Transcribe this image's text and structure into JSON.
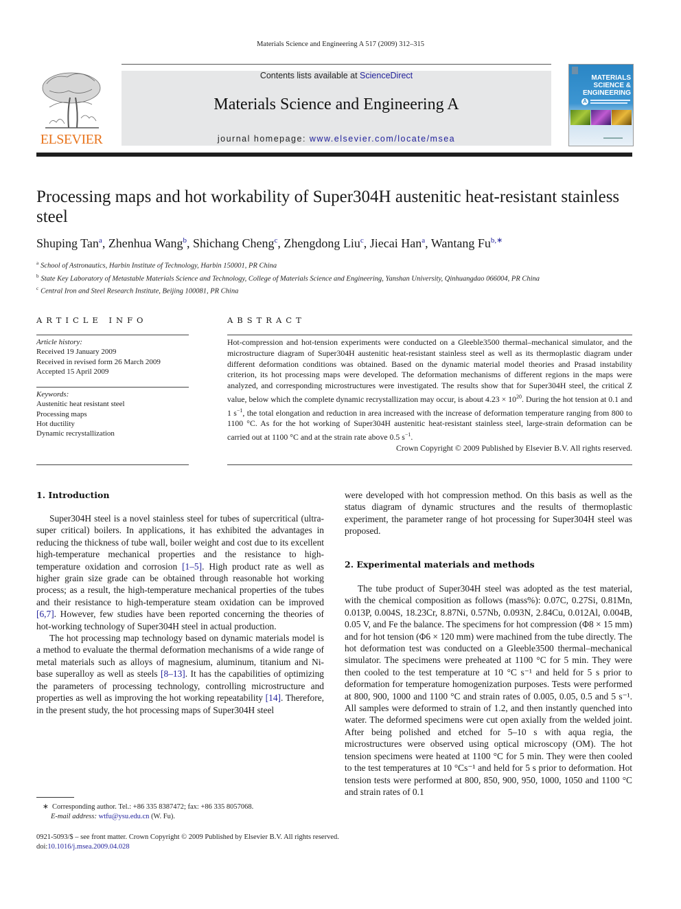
{
  "running_head": "Materials Science and Engineering A 517 (2009) 312–315",
  "header": {
    "publisher_logo_word": "ELSEVIER",
    "contents_prefix": "Contents lists available at ",
    "contents_link": "ScienceDirect",
    "journal_title": "Materials Science and Engineering A",
    "homepage_prefix": "journal homepage: ",
    "homepage_link": "www.elsevier.com/locate/msea",
    "cover": {
      "line1": "MATERIALS",
      "line2": "SCIENCE &",
      "line3": "ENGINEERING",
      "badge": "A"
    },
    "colors": {
      "elsevier_orange": "#e8741c",
      "link_blue": "#1f1f9a",
      "banner_gray": "#e6e7e8"
    }
  },
  "article": {
    "title": "Processing maps and hot workability of Super304H austenitic heat-resistant stainless steel",
    "authors": [
      {
        "name": "Shuping Tan",
        "sup": "a"
      },
      {
        "name": "Zhenhua Wang",
        "sup": "b"
      },
      {
        "name": "Shichang Cheng",
        "sup": "c"
      },
      {
        "name": "Zhengdong Liu",
        "sup": "c"
      },
      {
        "name": "Jiecai Han",
        "sup": "a"
      },
      {
        "name": "Wantang Fu",
        "sup": "b,∗"
      }
    ],
    "affiliations": [
      {
        "key": "a",
        "text": "School of Astronautics, Harbin Institute of Technology, Harbin 150001, PR China"
      },
      {
        "key": "b",
        "text": "State Key Laboratory of Metastable Materials Science and Technology, College of Materials Science and Engineering, Yanshan University, Qinhuangdao 066004, PR China"
      },
      {
        "key": "c",
        "text": "Central Iron and Steel Research Institute, Beijing 100081, PR China"
      }
    ]
  },
  "article_info": {
    "heading": "ARTICLE INFO",
    "history_label": "Article history:",
    "history": [
      "Received 19 January 2009",
      "Received in revised form 26 March 2009",
      "Accepted 15 April 2009"
    ],
    "keywords_label": "Keywords:",
    "keywords": [
      "Austenitic heat resistant steel",
      "Processing maps",
      "Hot ductility",
      "Dynamic recrystallization"
    ]
  },
  "abstract": {
    "heading": "ABSTRACT",
    "p1": "Hot-compression and hot-tension experiments were conducted on a Gleeble3500 thermal–mechanical simulator, and the microstructure diagram of Super304H austenitic heat-resistant stainless steel as well as its thermoplastic diagram under different deformation conditions was obtained. Based on the dynamic material model theories and Prasad instability criterion, its hot processing maps were developed. The deformation mechanisms of different regions in the maps were analyzed, and corresponding microstructures were investigated. The results show that for Super304H steel, the critical Z value, below which the complete dynamic recrystallization may occur, is about 4.23 × 10",
    "p1_exp": "20",
    "p2": ". During the hot tension at 0.1 and 1 s",
    "p2_exp": "−1",
    "p3": ", the total elongation and reduction in area increased with the increase of deformation temperature ranging from 800 to 1100 °C. As for the hot working of Super304H austenitic heat-resistant stainless steel, large-strain deformation can be carried out at 1100 °C and at the strain rate above 0.5 s",
    "p3_exp": "−1",
    "p4": ".",
    "copyright": "Crown Copyright © 2009 Published by Elsevier B.V. All rights reserved."
  },
  "section1": {
    "heading": "1.  Introduction",
    "para1_a": "Super304H steel is a novel stainless steel for tubes of supercritical (ultra-super critical) boilers. In applications, it has exhibited the advantages in reducing the thickness of tube wall, boiler weight and cost due to its excellent high-temperature mechanical properties and the resistance to high-temperature oxidation and corrosion ",
    "ref1": "[1–5]",
    "para1_b": ". High product rate as well as higher grain size grade can be obtained through reasonable hot working process; as a result, the high-temperature mechanical properties of the tubes and their resistance to high-temperature steam oxidation can be improved ",
    "ref2": "[6,7]",
    "para1_c": ". However, few studies have been reported concerning the theories of hot-working technology of Super304H steel in actual production.",
    "para2_a": "The hot processing map technology based on dynamic materials model is a method to evaluate the thermal deformation mechanisms of a wide range of metal materials such as alloys of magnesium, aluminum, titanium and Ni-base superalloy as well as steels ",
    "ref3": "[8–13]",
    "para2_b": ". It has the capabilities of optimizing the parameters of processing technology, controlling microstructure and properties as well as improving the hot working repeatability ",
    "ref4": "[14]",
    "para2_c": ". Therefore, in the present study, the hot processing maps of Super304H steel were developed with hot compression method. On this basis as well as the status diagram of dynamic structures and the results of thermoplastic experiment, the parameter range of hot processing for Super304H steel was proposed."
  },
  "section2": {
    "heading": "2.  Experimental materials and methods",
    "para1": "The tube product of Super304H steel was adopted as the test material, with the chemical composition as follows (mass%): 0.07C, 0.27Si, 0.81Mn, 0.013P, 0.004S, 18.23Cr, 8.87Ni, 0.57Nb, 0.093N, 2.84Cu, 0.012Al, 0.004B, 0.05 V, and Fe the balance. The specimens for hot compression (Φ8 × 15 mm) and for hot tension (Φ6 × 120 mm) were machined from the tube directly. The hot deformation test was conducted on a Gleeble3500 thermal–mechanical simulator. The specimens were preheated at 1100 °C for 5 min. They were then cooled to the test temperature at 10 °C s⁻¹ and held for 5 s prior to deformation for temperature homogenization purposes. Tests were performed at 800, 900, 1000 and 1100 °C and strain rates of 0.005, 0.05, 0.5 and 5 s⁻¹. All samples were deformed to strain of 1.2, and then instantly quenched into water. The deformed specimens were cut open axially from the welded joint. After being polished and etched for 5–10 s with aqua regia, the microstructures were observed using optical microscopy (OM). The hot tension specimens were heated at 1100 °C for 5 min. They were then cooled to the test temperatures at 10 °Cs⁻¹ and held for 5 s prior to deformation. Hot tension tests were performed at 800, 850, 900, 950, 1000, 1050 and 1100 °C and strain rates of 0.1"
  },
  "footnote": {
    "star": "∗",
    "corresponding": "Corresponding author. Tel.: +86 335 8387472; fax: +86 335 8057068.",
    "email_label": "E-mail address: ",
    "email": "wtfu@ysu.edu.cn",
    "email_suffix": " (W. Fu)."
  },
  "bottom": {
    "issn_line": "0921-5093/$ – see front matter. Crown Copyright © 2009 Published by Elsevier B.V. All rights reserved.",
    "doi_prefix": "doi:",
    "doi": "10.1016/j.msea.2009.04.028"
  }
}
